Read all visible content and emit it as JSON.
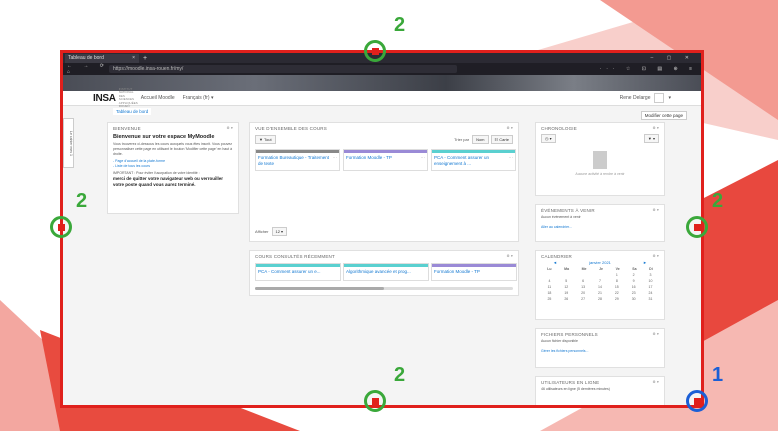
{
  "browser": {
    "tab_title": "Tableau de bord",
    "tab_close": "×",
    "new_tab": "+",
    "window_controls": "–  ▢  ✕",
    "nav_icons": "← → ⟳ ⌂",
    "url": "https://moodle.insa-rouen.fr/my/",
    "toolbar_icons": "··· ☆ ⊡ ▤ ⊕ ≡"
  },
  "header": {
    "logo": "INSA",
    "logo_sub": "INSTITUT NATIONAL DES SCIENCES APPLIQUÉES ROUEN",
    "home_link": "Accueil Moodle",
    "language": "Français (fr) ▾",
    "user_name": "Rene Delarge",
    "user_caret": "▾"
  },
  "sidebar_tab": "Le cahier mes 1",
  "breadcrumb": "Tableau de bord",
  "edit_button": "Modifier cette page",
  "welcome": {
    "title": "BIENVENUE",
    "heading": "Bienvenue sur votre espace MyMoodle",
    "p1": "Vous trouverez ci-dessous les cours auxquels vous êtes inscrit. Vous pouvez personnaliser cette page en utilisant le bouton 'Modifier cette page' en haut à droite.",
    "link1": "- Page d'accueil de la plate-forme",
    "link2": "- Liste de tous les cours",
    "important": "IMPORTANT : Pour éviter l'usurpation de votre identité :",
    "warning": "merci de quitter votre navigateur web ou verrouiller votre poste quand vous aurez terminé."
  },
  "overview": {
    "title": "VUE D'ENSEMBLE DES COURS",
    "filter_btn": "▼ Tout",
    "sort_label": "Trier par",
    "sort_btn": "Nom",
    "view_btn": "☷ Carte",
    "courses": [
      {
        "name": "Formation Bureautique - Traitement de texte",
        "color": "#888888"
      },
      {
        "name": "Formation Moodle - TP",
        "color": "#9a8ad6"
      },
      {
        "name": "PCA - Comment assurer un enseignement à ...",
        "color": "#5ad0d0"
      }
    ],
    "show_label": "Afficher",
    "show_value": "12 ▾"
  },
  "recent": {
    "title": "COURS CONSULTÉS RÉCEMMENT",
    "courses": [
      {
        "name": "PCA - Comment assurer un e...",
        "color": "#5ad0d0"
      },
      {
        "name": "Algorithmique avancée et prog...",
        "color": "#5ad0d0"
      },
      {
        "name": "Formation Moodle - TP",
        "color": "#9a8ad6"
      }
    ]
  },
  "timeline": {
    "title": "CHRONOLOGIE",
    "btn1": "◷ ▾",
    "btn2": "▼ ▾",
    "empty": "Aucune activité à rendre à venir"
  },
  "events": {
    "title": "ÉVÉNEMENTS À VENIR",
    "empty": "Aucun événement à venir",
    "link": "Aller au calendrier..."
  },
  "calendar": {
    "title": "CALENDRIER",
    "month": "janvier 2021",
    "prev": "◄",
    "next": "►",
    "days": [
      "Lu",
      "Ma",
      "Me",
      "Je",
      "Ve",
      "Sa",
      "Di"
    ],
    "weeks": [
      [
        "",
        "",
        "",
        "",
        "1",
        "2",
        "3"
      ],
      [
        "4",
        "5",
        "6",
        "7",
        "8",
        "9",
        "10"
      ],
      [
        "11",
        "12",
        "13",
        "14",
        "15",
        "16",
        "17"
      ],
      [
        "18",
        "19",
        "20",
        "21",
        "22",
        "23",
        "24"
      ],
      [
        "25",
        "26",
        "27",
        "28",
        "29",
        "30",
        "31"
      ]
    ]
  },
  "files": {
    "title": "FICHIERS PERSONNELS",
    "empty": "Aucun fichier disponible",
    "link": "Gérer les fichiers personnels..."
  },
  "online": {
    "title": "UTILISATEURS EN LIGNE",
    "text": "46 utilisateurs en ligne (5 dernières minutes)"
  },
  "block_controls": "⚙ ▾",
  "annotations": {
    "top": "2",
    "left": "2",
    "right": "2",
    "bottom": "2",
    "corner": "1"
  },
  "colors": {
    "accent_red": "#e0201c",
    "ring_green": "#3aa83a",
    "ring_blue": "#1b5fd6",
    "link_blue": "#1177d1"
  }
}
